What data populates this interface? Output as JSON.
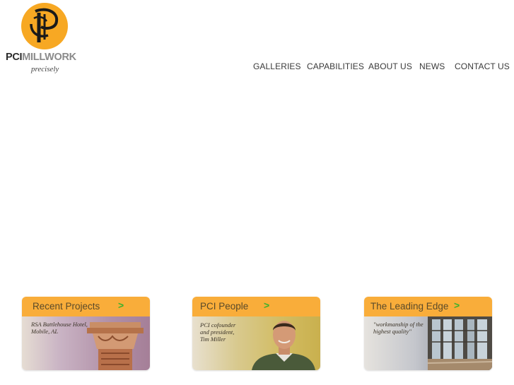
{
  "logo": {
    "brand_bold": "PCI",
    "brand_light": "MILLWORK",
    "tagline": "precisely",
    "accent": "#f7a823"
  },
  "nav": {
    "items": [
      {
        "label": "GALLERIES"
      },
      {
        "label": "CAPABILITIES"
      },
      {
        "label": "ABOUT US"
      },
      {
        "label": "NEWS"
      },
      {
        "label": "CONTACT US"
      }
    ]
  },
  "cards": [
    {
      "title": "Recent Projects",
      "arrow": ">",
      "caption": "RSA Battlehouse Hotel,\nMobile, AL"
    },
    {
      "title": "PCI People",
      "arrow": ">",
      "caption": "PCI cofounder\nand president,\nTim Miller"
    },
    {
      "title": "The Leading Edge",
      "arrow": ">",
      "caption": "\"workmanship of the\nhighest quality\""
    }
  ],
  "colors": {
    "card_header": "#f9ad3a",
    "arrow": "#3db12c",
    "nav_text": "#3a3a3a"
  },
  "icons": [
    "pci-logo-icon",
    "arrow-right-icon"
  ]
}
